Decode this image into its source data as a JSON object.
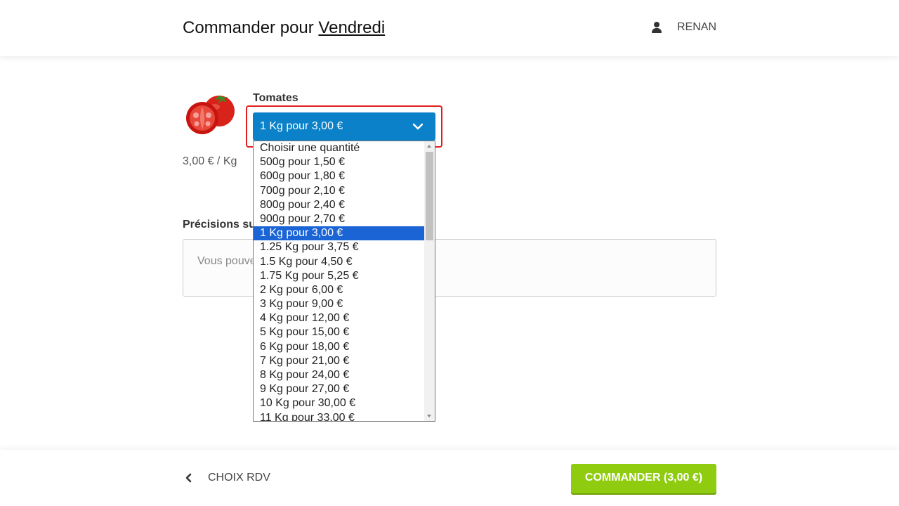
{
  "header": {
    "title_prefix": "Commander pour",
    "title_day": "Vendredi",
    "user_name": "RENAN",
    "user_icon": "user-icon"
  },
  "product": {
    "name": "Tomates",
    "unit_price": "3,00 € / Kg",
    "image_icon": "tomato-image"
  },
  "quantity_select": {
    "selected": "1 Kg pour 3,00 €",
    "selected_index": 6,
    "options": [
      "Choisir une quantité",
      "500g pour 1,50 €",
      "600g pour 1,80 €",
      "700g pour 2,10 €",
      "800g pour 2,40 €",
      "900g pour 2,70 €",
      "1 Kg pour 3,00 €",
      "1.25 Kg pour 3,75 €",
      "1.5 Kg pour 4,50 €",
      "1.75 Kg pour 5,25 €",
      "2 Kg pour 6,00 €",
      "3 Kg pour 9,00 €",
      "4 Kg pour 12,00 €",
      "5 Kg pour 15,00 €",
      "6 Kg pour 18,00 €",
      "7 Kg pour 21,00 €",
      "8 Kg pour 24,00 €",
      "9 Kg pour 27,00 €",
      "10 Kg pour 30,00 €",
      "11 Kg pour 33,00 €"
    ]
  },
  "notes": {
    "label": "Précisions su",
    "placeholder": "Vous pouve"
  },
  "footer": {
    "back_label": "CHOIX RDV",
    "order_label": "COMMANDER (3,00 €)"
  },
  "colors": {
    "select_bg": "#0a81c8",
    "select_border": "#e02020",
    "option_selected": "#1a64d6",
    "order_button": "#8fcc10"
  }
}
